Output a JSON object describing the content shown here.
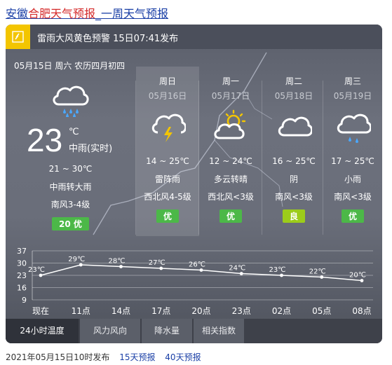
{
  "title": {
    "prefix": "安徽",
    "city": "合肥天气预报",
    "sep": "_",
    "suffix": "一周天气预报"
  },
  "alert": {
    "text": "雷雨大风黄色预警 15日07:41发布",
    "color": "#f3c500"
  },
  "today": {
    "date": "05月15日 周六 农历四月初四",
    "icon": "rain-cloud-icon",
    "temp": "23",
    "unit": "℃",
    "desc": "中雨(实时)",
    "range": "21 ~ 30℃",
    "cond": "中雨转大雨",
    "wind": "南风3-4级",
    "aqi": "20 优",
    "aqi_color": "#4cb848"
  },
  "days": [
    {
      "week": "周日",
      "date": "05月16日",
      "icon": "thunderstorm-icon",
      "range": "14 ~ 25℃",
      "cond": "雷阵雨",
      "wind": "西北风4-5级",
      "aqi": "优",
      "aqi_color": "#4cb848"
    },
    {
      "week": "周一",
      "date": "05月17日",
      "icon": "partly-cloudy-icon",
      "range": "12 ~ 24℃",
      "cond": "多云转晴",
      "wind": "西北风<3级",
      "aqi": "优",
      "aqi_color": "#4cb848"
    },
    {
      "week": "周二",
      "date": "05月18日",
      "icon": "cloudy-icon",
      "range": "16 ~ 25℃",
      "cond": "阴",
      "wind": "南风<3级",
      "aqi": "良",
      "aqi_color": "#9ccc1a"
    },
    {
      "week": "周三",
      "date": "05月19日",
      "icon": "light-rain-icon",
      "range": "17 ~ 25℃",
      "cond": "小雨",
      "wind": "南风<3级",
      "aqi": "优",
      "aqi_color": "#4cb848"
    }
  ],
  "chart_data": {
    "type": "line",
    "categories": [
      "现在",
      "11点",
      "14点",
      "17点",
      "20点",
      "23点",
      "02点",
      "05点",
      "08点"
    ],
    "values": [
      23,
      29,
      28,
      27,
      26,
      24,
      23,
      22,
      20
    ],
    "labels": [
      "23℃",
      "29℃",
      "28℃",
      "27℃",
      "26℃",
      "24℃",
      "23℃",
      "22℃",
      "20℃"
    ],
    "y_ticks": [
      "37",
      "30",
      "23",
      "16",
      "9"
    ],
    "ylim": [
      9,
      37
    ],
    "grid": true
  },
  "tabs": [
    "24小时温度",
    "风力风向",
    "降水量",
    "相关指数"
  ],
  "footer": {
    "published": "2021年05月15日10时发布",
    "link15": "15天预报",
    "link40": "40天预报"
  }
}
